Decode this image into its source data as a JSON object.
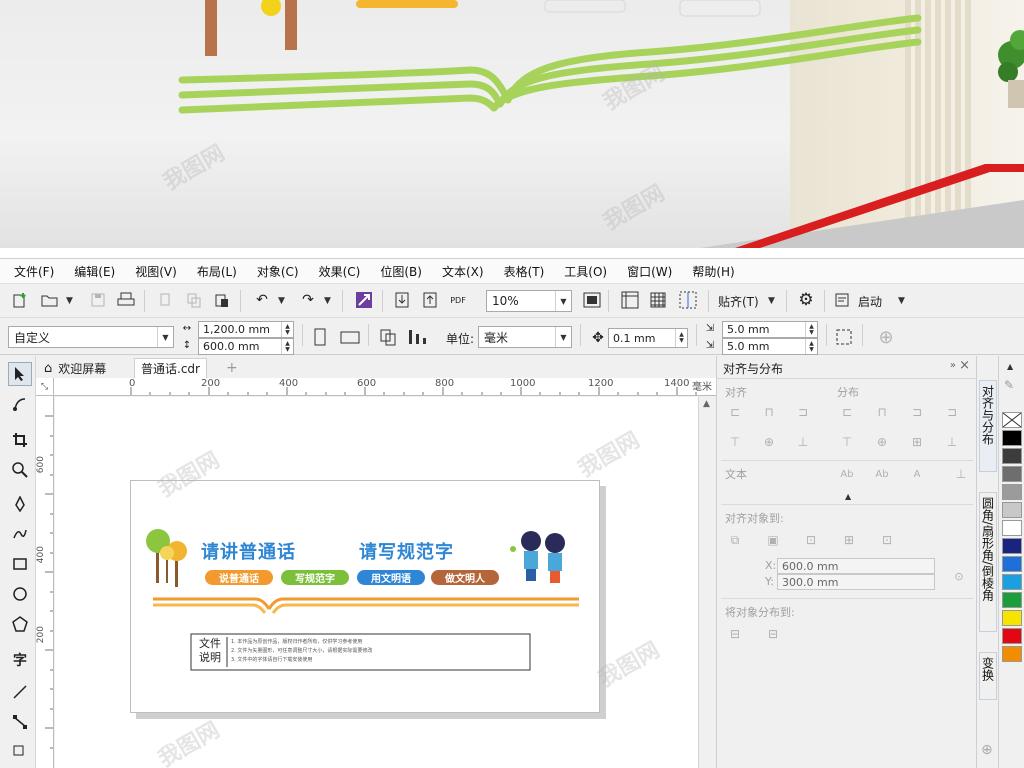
{
  "menu": [
    "文件(F)",
    "编辑(E)",
    "视图(V)",
    "布局(L)",
    "对象(C)",
    "效果(C)",
    "位图(B)",
    "文本(X)",
    "表格(T)",
    "工具(O)",
    "窗口(W)",
    "帮助(H)"
  ],
  "toolbar": {
    "zoom_value": "10%",
    "snap_label": "贴齐(T)",
    "launch_label": "启动",
    "pdf_label": "PDF"
  },
  "property_bar": {
    "page_preset": "自定义",
    "width": "1,200.0 mm",
    "height": "600.0 mm",
    "units_label": "单位:",
    "units_value": "毫米",
    "nudge": "0.1 mm",
    "dup_x": "5.0 mm",
    "dup_y": "5.0 mm"
  },
  "tabs": {
    "welcome": "欢迎屏幕",
    "document": "普通话.cdr"
  },
  "ruler": {
    "h_ticks": [
      "0",
      "200",
      "400",
      "600",
      "800",
      "1000",
      "1200",
      "1400"
    ],
    "unit": "毫米",
    "v_ticks": [
      "600",
      "400",
      "200"
    ],
    "corner": "⤡"
  },
  "design": {
    "title_left": "请讲普通话",
    "title_right": "请写规范字",
    "pills": [
      "说普通话",
      "写规范字",
      "用文明语",
      "做文明人"
    ],
    "pill_colors": [
      "#f29a2e",
      "#7cbf3a",
      "#2f86d4",
      "#b5653a"
    ],
    "caption_title": "文件说明",
    "caption_lines": [
      "1. 本作品为原创作品，版权归作者所有，仅供学习参考使用",
      "2. 文件为矢量图形，可任意调整尺寸大小，请根据实际需要修改",
      "3. 文件中的字体请自行下载安装使用"
    ]
  },
  "docker": {
    "title": "对齐与分布",
    "align_label": "对齐",
    "distribute_label": "分布",
    "text_label": "文本",
    "align_to_label": "对齐对象到:",
    "x_value": "600.0 mm",
    "y_value": "300.0 mm",
    "x_label": "X:",
    "y_label": "Y:",
    "distribute_to_label": "将对象分布到:"
  },
  "side_tabs": [
    "对齐与分布",
    "圆角/扇形角/倒棱角",
    "变换"
  ],
  "palette_colors": [
    "#ffffff",
    "#000000",
    "#3c3c3c",
    "#6e6e6e",
    "#9b9b9b",
    "#c8c8c8",
    "#ffffff",
    "#1a237e",
    "#1e6fd9",
    "#1aa0e0",
    "#1b9e3a",
    "#f6e300",
    "#e30613",
    "#f28c00"
  ]
}
